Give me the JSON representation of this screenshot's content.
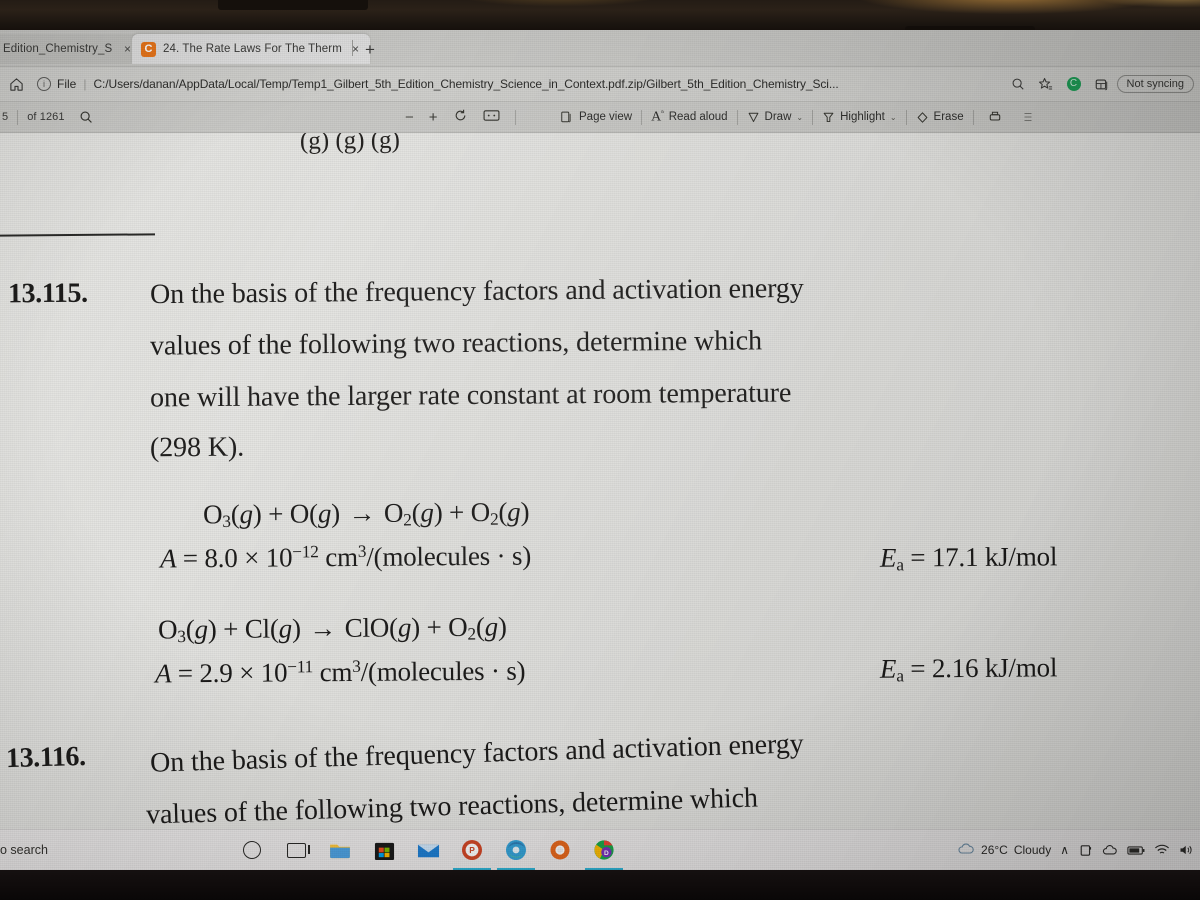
{
  "browser": {
    "tabs": [
      {
        "title": "Edition_Chemistry_S",
        "favicon": "",
        "active": false,
        "close_label": "×"
      },
      {
        "title": "24. The Rate Laws For The Therm",
        "favicon": "C",
        "active": true,
        "close_label": "×"
      }
    ],
    "new_tab_label": "+",
    "address": {
      "security_label": "File",
      "info_icon": "i",
      "separator": "|",
      "url": "C:/Users/danan/AppData/Local/Temp/Temp1_Gilbert_5th_Edition_Chemistry_Science_in_Context.pdf.zip/Gilbert_5th_Edition_Chemistry_Sci...",
      "sync_label": "Not syncing",
      "icons": {
        "home": "home-icon",
        "zoom": "zoom-icon",
        "favorite": "favorites-star-icon",
        "copilot": "copilot-icon",
        "collections": "collections-icon"
      }
    }
  },
  "pdf_toolbar": {
    "page_of_label": "of 1261",
    "page_current_partial": "5",
    "search_icon": "search-icon",
    "zoom_out_label": "−",
    "zoom_in_label": "+",
    "rotate_icon": "rotate-icon",
    "fit_icon": "fit-to-page-icon",
    "buttons": [
      {
        "label": "Page view",
        "icon": "page-view-icon",
        "chevron": false
      },
      {
        "label": "Read aloud",
        "icon": "read-aloud-icon",
        "chevron": false
      },
      {
        "label": "Draw",
        "icon": "draw-pen-icon",
        "chevron": true
      },
      {
        "label": "Highlight",
        "icon": "highlighter-icon",
        "chevron": true
      },
      {
        "label": "Erase",
        "icon": "eraser-icon",
        "chevron": false
      }
    ],
    "print_icon": "print-icon",
    "more_icon": "more-options-icon",
    "chevron_glyph": "⌄"
  },
  "document": {
    "cutoff_top_text": "(g)        (g)        (g)",
    "problems": [
      {
        "number": "13.115.",
        "lines": [
          "On the basis of the frequency factors and activation energy",
          "values of the following two reactions, determine which",
          "one will have the larger rate constant at room temperature",
          "(298 K)."
        ],
        "reactions": [
          {
            "equation_html": "O<sub>3</sub>(<i>g</i>) + O(<i>g</i>) <span class='arrow'>→</span> O<sub>2</sub>(<i>g</i>) + O<sub>2</sub>(<i>g</i>)",
            "frequency_factor_html": "<i>A</i> = 8.0 × 10<sup>−12</sup> cm<sup>3</sup>/(molecules · s)",
            "activation_energy_html": "<i>E</i><sub>a</sub> = 17.1 kJ/mol"
          },
          {
            "equation_html": "O<sub>3</sub>(<i>g</i>) + Cl(<i>g</i>) <span class='arrow'>→</span> ClO(<i>g</i>) + O<sub>2</sub>(<i>g</i>)",
            "frequency_factor_html": "<i>A</i> = 2.9 × 10<sup>−11</sup> cm<sup>3</sup>/(molecules · s)",
            "activation_energy_html": "<i>E</i><sub>a</sub> = 2.16 kJ/mol"
          }
        ]
      },
      {
        "number": "13.116.",
        "lines": [
          "On the basis of the frequency factors and activation energy",
          "values of the following two reactions, determine which"
        ],
        "reactions": []
      }
    ]
  },
  "taskbar": {
    "search_text": "o search",
    "start_icon": "windows-start-icon",
    "cortana_icon": "cortana-circle-icon",
    "taskview_icon": "task-view-icon",
    "apps": [
      {
        "name": "file-explorer-icon",
        "active": false
      },
      {
        "name": "microsoft-store-icon",
        "active": false
      },
      {
        "name": "mail-icon",
        "active": false
      },
      {
        "name": "powerpoint-icon",
        "active": true
      },
      {
        "name": "edge-browser-icon",
        "active": true
      },
      {
        "name": "firefox-icon",
        "active": false
      },
      {
        "name": "chrome-icon",
        "active": true
      }
    ],
    "tray": {
      "weather_temp": "26°C",
      "weather_condition": "Cloudy",
      "weather_icon": "cloud-icon",
      "chevron_up": "∧",
      "icons": [
        "onedrive-icon",
        "cloud-sync-icon",
        "battery-icon",
        "wifi-icon",
        "volume-icon"
      ]
    }
  },
  "colors": {
    "accent": "#2fb2d4",
    "chrome_bg": "#cfcfcc",
    "page_bg": "#e4e4e1",
    "taskbar_bg": "#eceaea",
    "text": "#1d1c1b",
    "sync_green": "#1e9e57"
  }
}
